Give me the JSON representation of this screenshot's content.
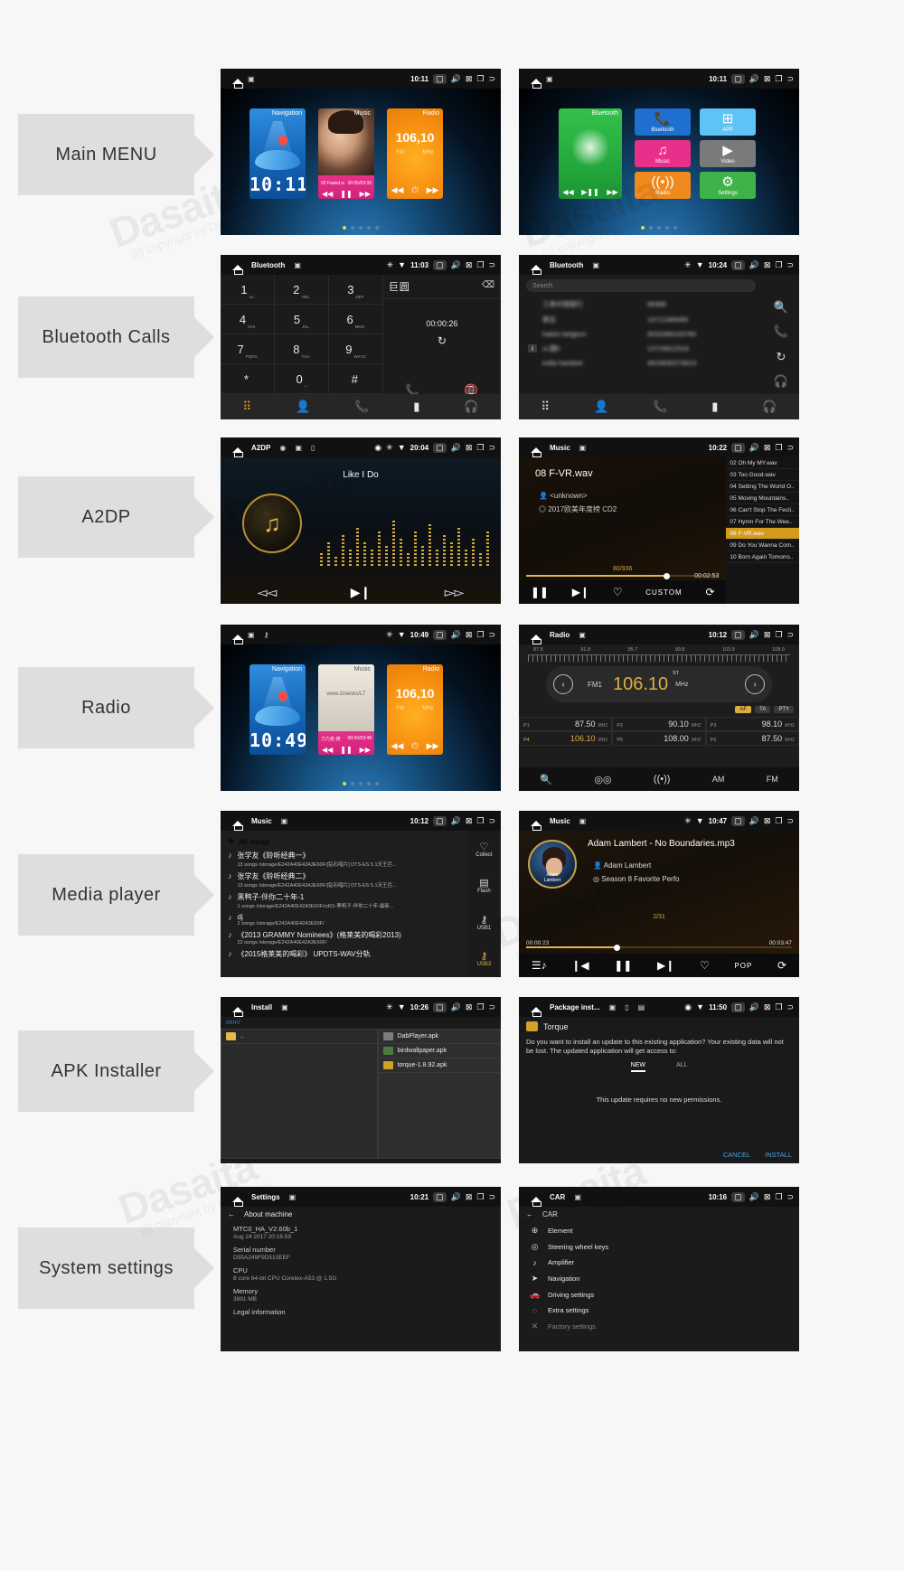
{
  "page": {
    "watermark_big": "Dasaita",
    "watermark_small": "|||| copyright by Dasaita/||||"
  },
  "sections": [
    {
      "label": "Main MENU"
    },
    {
      "label": "Bluetooth Calls"
    },
    {
      "label": "A2DP"
    },
    {
      "label": "Radio"
    },
    {
      "label": "Media player"
    },
    {
      "label": "APK Installer"
    },
    {
      "label": "System settings"
    }
  ],
  "screens": {
    "main_menu_1": {
      "statusbar": {
        "title": "",
        "clock": "10:11",
        "icons": [
          "image-icon",
          "camera-icon",
          "volume-icon",
          "close-icon",
          "window-icon",
          "back-icon"
        ]
      },
      "tiles": {
        "navigation": {
          "label": "Navigation",
          "clock": "10:11"
        },
        "music": {
          "label": "Music",
          "track": "02 Faded.w",
          "time": "00:05/03:35"
        },
        "radio": {
          "label": "Radio",
          "freq": "106,10",
          "band": "FM",
          "unit": "MHz"
        }
      },
      "page_dots": 5,
      "active_dot": 1
    },
    "main_menu_2": {
      "statusbar": {
        "clock": "10:11"
      },
      "bluetooth_tile": {
        "label": "Bluetooth"
      },
      "apps": [
        {
          "label": "Bluetooth",
          "icon": "phone-icon",
          "color": "#1e6fd0"
        },
        {
          "label": "APP",
          "icon": "apps-icon",
          "color": "#5ec3f5"
        },
        {
          "label": "Music",
          "icon": "music-note-icon",
          "color": "#e8308a"
        },
        {
          "label": "Video",
          "icon": "play-icon",
          "color": "#7a7a7a"
        },
        {
          "label": "Radio",
          "icon": "radio-tower-icon",
          "color": "#f08a1c"
        },
        {
          "label": "Settings",
          "icon": "gear-icon",
          "color": "#3fb34a"
        }
      ],
      "page_dots": 5,
      "active_dot": 1
    },
    "bt_dialer": {
      "statusbar": {
        "title": "Bluetooth",
        "clock": "11:03",
        "bt": "bluetooth-icon",
        "wifi": "wifi-icon"
      },
      "keys": [
        {
          "d": "1",
          "s": "oo"
        },
        {
          "d": "2",
          "s": "ABC"
        },
        {
          "d": "3",
          "s": "DEF"
        },
        {
          "d": "4",
          "s": "GHI"
        },
        {
          "d": "5",
          "s": "JKL"
        },
        {
          "d": "6",
          "s": "MNO"
        },
        {
          "d": "7",
          "s": "PQRS"
        },
        {
          "d": "8",
          "s": "TUV"
        },
        {
          "d": "9",
          "s": "WXYZ"
        },
        {
          "d": "*",
          "s": ""
        },
        {
          "d": "0",
          "s": "+"
        },
        {
          "d": "#",
          "s": ""
        }
      ],
      "number": "巨圆",
      "duration": "00:00:26",
      "tabs": [
        "keypad-icon",
        "contacts-icon",
        "call-log-icon",
        "favorites-icon",
        "bt-device-icon"
      ]
    },
    "bt_contacts": {
      "statusbar": {
        "title": "Bluetooth",
        "clock": "10:24"
      },
      "search_placeholder": "Search",
      "contacts": [
        {
          "name": "工商中国银行",
          "number": "95588"
        },
        {
          "name": "郭总",
          "number": "13711389465"
        },
        {
          "name": "hakim belgium",
          "number": "0032486143760"
        },
        {
          "name": "ui 圆h",
          "number": "13719612316"
        },
        {
          "name": "india handset",
          "number": "4919930274613"
        }
      ],
      "rail": [
        "search-icon",
        "call-icon",
        "sync-icon",
        "bt-device-icon"
      ],
      "tabs": [
        "keypad-icon",
        "contacts-icon",
        "call-log-icon",
        "favorites-icon",
        "bt-device-icon"
      ]
    },
    "a2dp": {
      "statusbar": {
        "title": "A2DP",
        "clock": "20:04"
      },
      "song": "Like I Do",
      "controls": [
        "prev-icon",
        "play-pause-icon",
        "next-icon"
      ]
    },
    "music_player": {
      "statusbar": {
        "title": "Music",
        "clock": "10:22"
      },
      "track": "08 F-VR.wav",
      "artist": "<unknown>",
      "album": "2017欧美年度榜 CD2",
      "index": "80/936",
      "time": "00:02:53",
      "controls": [
        "pause-icon",
        "next-icon",
        "favorite-icon",
        "CUSTOM",
        "repeat-icon"
      ],
      "playlist": [
        "02 Oh My MY.wav",
        "03 Too Good.wav",
        "04 Setting The World O..",
        "05 Moving Mountains..",
        "06 Can't Stop The Fecli..",
        "07 Hymn For The Wee..",
        "08 F-VR.wav",
        "09 Do You Wanna Com..",
        "10 Born Again Tomorro.."
      ],
      "playlist_selected": 6
    },
    "radio_menu": {
      "statusbar": {
        "clock": "10:49"
      },
      "tiles": {
        "navigation": {
          "label": "Navigation",
          "clock": "10:49"
        },
        "music": {
          "label": "Music",
          "track": "力力走-夜",
          "time": "00:00/03:48",
          "site": "www.Grienks/LT"
        },
        "radio": {
          "label": "Radio",
          "freq": "106,10",
          "band": "FM",
          "unit": "MHz"
        }
      },
      "page_dots": 5,
      "active_dot": 1
    },
    "radio": {
      "statusbar": {
        "title": "Radio",
        "clock": "10:12"
      },
      "scale_ticks": [
        "87.5",
        "91.8",
        "95.7",
        "99.8",
        "103.9",
        "108.0"
      ],
      "band": "FM1",
      "frequency": "106.10",
      "unit": "MHz",
      "stereo": "ST",
      "rds": [
        {
          "label": "AF",
          "active": true
        },
        {
          "label": "TA",
          "active": false
        },
        {
          "label": "PTY",
          "active": false
        }
      ],
      "presets": [
        {
          "id": "P1",
          "freq": "87.50",
          "unit": "MHZ",
          "active": false
        },
        {
          "id": "P2",
          "freq": "90.10",
          "unit": "MHZ",
          "active": false
        },
        {
          "id": "P3",
          "freq": "98.10",
          "unit": "MHZ",
          "active": false
        },
        {
          "id": "P4",
          "freq": "106.10",
          "unit": "MHZ",
          "active": true
        },
        {
          "id": "P5",
          "freq": "108.00",
          "unit": "MHZ",
          "active": false
        },
        {
          "id": "P6",
          "freq": "87.50",
          "unit": "MHZ",
          "active": false
        }
      ],
      "bottom": [
        "search-icon",
        "stereo-icon",
        "signal-icon",
        "AM",
        "FM"
      ]
    },
    "song_list": {
      "statusbar": {
        "title": "Music",
        "clock": "10:12"
      },
      "all_songs": "All songs",
      "items": [
        {
          "title": "张学友《聆听经典一》",
          "sub": "13 songs /storage/E242A40E42A3E60F/[钻石唱片] DTS-ES 5.1天王巨..."
        },
        {
          "title": "张学友《聆听经典二》",
          "sub": "13 songs /storage/E242A40E42A3E60F/[钻石唱片] DTS-ES 5.1天王巨..."
        },
        {
          "title": "黑鸭子-伴你二十年-1",
          "sub": "1 songs /storage/E242A40E42A3E60F/cd01-黑鸭子-伴你二十年-最新..."
        },
        {
          "title": "dj",
          "sub": "2 songs /storage/E242A40E42A3E60F/"
        },
        {
          "title": "《2013 GRAMMY Nominees》(格莱美的喝彩2013)",
          "sub": "22 songs /storage/E242A40E42A3E60F/"
        },
        {
          "title": "《2015格莱美的喝彩》 UPDTS-WAV分轨",
          "sub": ""
        }
      ],
      "side_buttons": [
        {
          "label": "Collect",
          "icon": "heart-icon",
          "active": false
        },
        {
          "label": "Flash",
          "icon": "flash-icon",
          "active": false
        },
        {
          "label": "USB1",
          "icon": "usb-icon",
          "active": false
        },
        {
          "label": "USB3",
          "icon": "usb-icon",
          "active": true
        }
      ]
    },
    "media_now_playing": {
      "statusbar": {
        "title": "Music",
        "clock": "10:47"
      },
      "track": "Adam Lambert - No Boundaries.mp3",
      "artist": "Adam Lambert",
      "album": "Season 8 Favorite Perfo",
      "index": "2/31",
      "elapsed": "00:00:23",
      "total": "00:03:47",
      "mode": "POP",
      "controls": [
        "playlist-icon",
        "prev-icon",
        "pause-icon",
        "next-icon",
        "favorite-icon",
        "POP",
        "repeat-icon"
      ]
    },
    "apk_installer": {
      "statusbar": {
        "title": "Install",
        "clock": "10:26"
      },
      "path": "oem/",
      "parent_entry": "..",
      "files": [
        {
          "name": "DabPlayer.apk",
          "icon": "apk-icon"
        },
        {
          "name": "birdwallpaper.apk",
          "icon": "apk-icon"
        },
        {
          "name": "torque-1.8.92.apk",
          "icon": "apk-icon"
        }
      ]
    },
    "package_installer": {
      "statusbar": {
        "title": "Package inst...",
        "clock": "11:50"
      },
      "app_name": "Torque",
      "body": "Do you want to install an update to this existing application? Your existing data will not be lost. The updated application will get access to:",
      "tabs": [
        {
          "label": "NEW",
          "active": true
        },
        {
          "label": "ALL",
          "active": false
        }
      ],
      "note": "This update requires no new permissions.",
      "buttons": [
        "CANCEL",
        "INSTALL"
      ]
    },
    "settings_about": {
      "statusbar": {
        "title": "Settings",
        "clock": "10:21"
      },
      "back_title": "About machine",
      "groups": [
        {
          "key": "MTC0_HA_V2.60b_1",
          "value": "Aug 24 2017 20:16:59"
        },
        {
          "key": "Serial number",
          "value": "D55A249F9D510EEF"
        },
        {
          "key": "CPU",
          "value": "8 core 64-bit CPU Coretex-A53 @ 1.5G"
        },
        {
          "key": "Memory",
          "value": "3891 MB"
        },
        {
          "key": "Legal information",
          "value": ""
        }
      ]
    },
    "settings_car": {
      "statusbar": {
        "title": "CAR",
        "clock": "10:16"
      },
      "back_title": "CAR",
      "rows": [
        {
          "label": "Element",
          "icon": "car-icon"
        },
        {
          "label": "Steering wheel keys",
          "icon": "steering-icon"
        },
        {
          "label": "Amplifier",
          "icon": "amp-icon"
        },
        {
          "label": "Navigation",
          "icon": "nav-icon"
        },
        {
          "label": "Driving settings",
          "icon": "drive-icon"
        },
        {
          "label": "Extra settings",
          "icon": "extra-icon"
        },
        {
          "label": "Factory settings",
          "icon": "factory-icon"
        }
      ]
    }
  }
}
